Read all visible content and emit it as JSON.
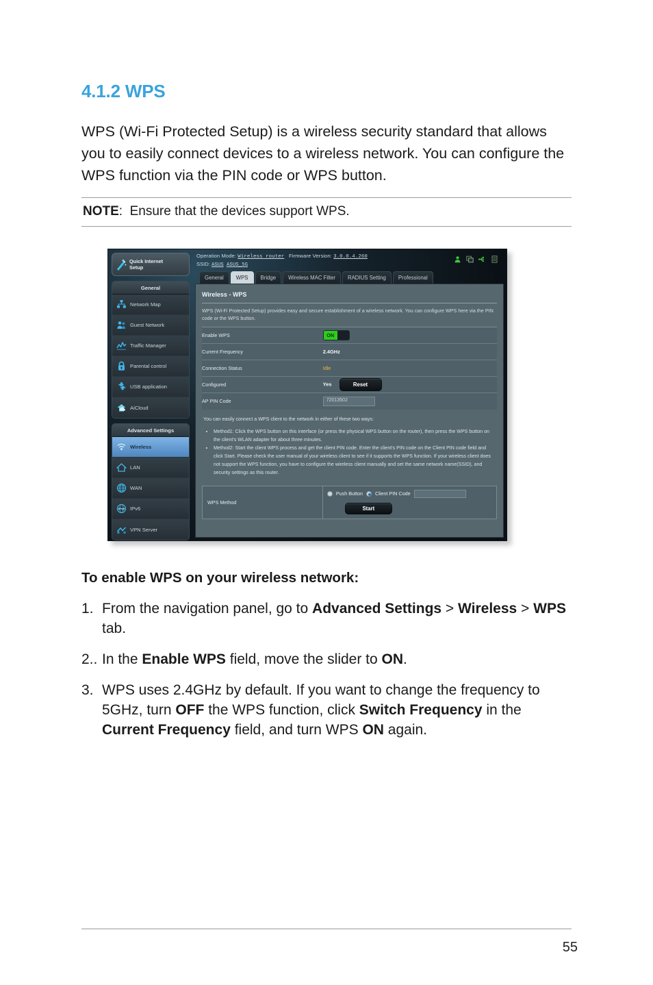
{
  "document": {
    "section_number_title": "4.1.2 WPS",
    "intro_paragraph": "WPS (Wi-Fi Protected Setup) is a wireless security standard that allows you to easily connect devices to a wireless network. You can configure the WPS function via the PIN code or WPS button.",
    "note_label": "NOTE",
    "note_separator": ":",
    "note_text": "Ensure that the devices support WPS.",
    "page_number": "55",
    "accent_color": "#3ba3dd"
  },
  "instructions": {
    "heading": "To enable WPS on your wireless network:",
    "items": [
      {
        "number": "1.",
        "parts": [
          {
            "t": "From the navigation panel, go to ",
            "b": false
          },
          {
            "t": "Advanced Settings",
            "b": true
          },
          {
            "t": " > ",
            "b": false
          },
          {
            "t": "Wireless",
            "b": true
          },
          {
            "t": " > ",
            "b": false
          },
          {
            "t": "WPS",
            "b": true
          },
          {
            "t": " tab.",
            "b": false
          }
        ]
      },
      {
        "number": "2..",
        "parts": [
          {
            "t": "In the ",
            "b": false
          },
          {
            "t": "Enable WPS",
            "b": true
          },
          {
            "t": " field, move the slider to ",
            "b": false
          },
          {
            "t": "ON",
            "b": true
          },
          {
            "t": ".",
            "b": false
          }
        ]
      },
      {
        "number": "3.",
        "parts": [
          {
            "t": "WPS uses 2.4GHz by default. If you want to change the frequency to 5GHz, turn ",
            "b": false
          },
          {
            "t": "OFF",
            "b": true
          },
          {
            "t": " the WPS function, click ",
            "b": false
          },
          {
            "t": "Switch Frequency",
            "b": true
          },
          {
            "t": " in the ",
            "b": false
          },
          {
            "t": "Current Frequency",
            "b": true
          },
          {
            "t": " field, and turn WPS ",
            "b": false
          },
          {
            "t": "ON",
            "b": true
          },
          {
            "t": " again.",
            "b": false
          }
        ]
      }
    ]
  },
  "router_ui": {
    "quick_setup": {
      "label_line1": "Quick Internet",
      "label_line2": "Setup",
      "icon": "magic-wand-icon"
    },
    "header": {
      "operation_mode_label": "Operation Mode:",
      "operation_mode_value": "Wireless router",
      "firmware_label": "Firmware Version:",
      "firmware_value": "3.0.0.4.260",
      "ssid_label": "SSID:",
      "ssid_value_1": "ASUS",
      "ssid_value_2": "ASUS_5G",
      "status_icons": [
        "user-icon",
        "network-icon",
        "usb-icon",
        "log-icon"
      ],
      "status_icon_color": "#3ec93a"
    },
    "tabs": [
      {
        "label": "General",
        "active": false
      },
      {
        "label": "WPS",
        "active": true
      },
      {
        "label": "Bridge",
        "active": false
      },
      {
        "label": "Wireless MAC Filter",
        "active": false
      },
      {
        "label": "RADIUS Setting",
        "active": false
      },
      {
        "label": "Professional",
        "active": false
      }
    ],
    "sidebar": {
      "groups": [
        {
          "header": "General",
          "items": [
            {
              "label": "Network Map",
              "icon": "network-map-icon",
              "selected": false
            },
            {
              "label": "Guest Network",
              "icon": "guest-network-icon",
              "selected": false
            },
            {
              "label": "Traffic Manager",
              "icon": "traffic-manager-icon",
              "selected": false
            },
            {
              "label": "Parental control",
              "icon": "lock-icon",
              "selected": false
            },
            {
              "label": "USB application",
              "icon": "usb-application-icon",
              "selected": false
            },
            {
              "label": "AiCloud",
              "icon": "cloud-icon",
              "selected": false
            }
          ]
        },
        {
          "header": "Advanced Settings",
          "items": [
            {
              "label": "Wireless",
              "icon": "wifi-icon",
              "selected": true
            },
            {
              "label": "LAN",
              "icon": "home-icon",
              "selected": false
            },
            {
              "label": "WAN",
              "icon": "globe-icon",
              "selected": false
            },
            {
              "label": "IPv6",
              "icon": "ipv6-globe-icon",
              "selected": false
            },
            {
              "label": "VPN Server",
              "icon": "vpn-icon",
              "selected": false
            }
          ]
        }
      ]
    },
    "panel": {
      "title": "Wireless - WPS",
      "description": "WPS (Wi-Fi Protected Setup) provides easy and secure establishment of a wireless network. You can configure WPS here via the PIN code or the WPS button.",
      "settings": [
        {
          "key": "Enable WPS",
          "type": "toggle",
          "value": "ON"
        },
        {
          "key": "Current Frequency",
          "type": "text",
          "value": "2.4GHz"
        },
        {
          "key": "Connection Status",
          "type": "status",
          "value": "Idle"
        },
        {
          "key": "Configured",
          "type": "configured",
          "value": "Yes",
          "button": "Reset"
        },
        {
          "key": "AP PIN Code",
          "type": "input",
          "value": "72013502"
        }
      ],
      "methods_intro": "You can easily connect a WPS client to the network in either of these two ways:",
      "methods": [
        "Method1: Click the WPS button on this interface (or press the physical WPS button on the router), then press the WPS button on the client's WLAN adapter for about three minutes.",
        "Method2: Start the client WPS process and get the client PIN code. Enter the client's PIN code on the Client PIN code field and click Start. Please check the user manual of your wireless client to see if it supports the WPS function. If your wireless client does not support the WPS function, you have to configure the wireless client manually and set the same network name(SSID), and security settings as this router."
      ],
      "wps_method": {
        "key": "WPS Method",
        "option_push_button": "Push Button",
        "option_client_pin": "Client PIN Code",
        "selected_option": "Client PIN Code",
        "client_pin_value": "",
        "start_button": "Start"
      }
    }
  }
}
